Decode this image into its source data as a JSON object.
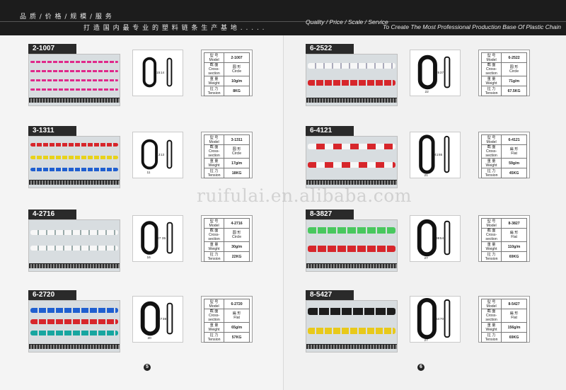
{
  "header": {
    "cn_line1": "品 质  / 价 格  / 规 模  / 服 务",
    "cn_line2": "打 造 国 内 最 专 业 的 塑 料 链 条 生 产 基 地 . . . . .",
    "en_line1": "Quality / Price / Scale / Service",
    "en_line2": "To Create The Most Professional Production Base Of Plastic Chain"
  },
  "watermark": "ruifulai.en.alibaba.com",
  "spec_labels": {
    "model_cn": "型 号",
    "model_en": "Model",
    "cross_cn": "截 面",
    "cross_en": "Cross-section",
    "weight_cn": "重 量",
    "weight_en": "Weight",
    "tension_cn": "拉 力",
    "tension_en": "Tension"
  },
  "products_left": [
    {
      "code": "2-1007",
      "model": "2-1007",
      "section_cn": "圆 形",
      "section_en": "Circle",
      "weight": "10g/m",
      "tension": "8KG",
      "dim_a": "15",
      "dim_b": "14",
      "dim_c": ""
    },
    {
      "code": "3-1311",
      "model": "3-1311",
      "section_cn": "圆 形",
      "section_en": "Circle",
      "weight": "17g/m",
      "tension": "18KG",
      "dim_a": "13",
      "dim_b": "13",
      "dim_c": "11"
    },
    {
      "code": "4-2716",
      "model": "4-2716",
      "section_cn": "圆 形",
      "section_en": "Circle",
      "weight": "30g/m",
      "tension": "22KG",
      "dim_a": "27",
      "dim_b": "35",
      "dim_c": "16"
    },
    {
      "code": "6-2720",
      "model": "6-2720",
      "section_cn": "扁 形",
      "section_en": "Flat",
      "weight": "65g/m",
      "tension": "57KG",
      "dim_a": "27",
      "dim_b": "38",
      "dim_c": "20"
    }
  ],
  "products_right": [
    {
      "code": "6-2522",
      "model": "6-2522",
      "section_cn": "圆 形",
      "section_en": "Circle",
      "weight": "71g/m",
      "tension": "67.5KG",
      "dim_a": "25",
      "dim_b": "37",
      "dim_c": "22"
    },
    {
      "code": "6-4121",
      "model": "6-4121",
      "section_cn": "扁 形",
      "section_en": "Flat",
      "weight": "59g/m",
      "tension": "45KG",
      "dim_a": "41",
      "dim_b": "55",
      "dim_c": "21"
    },
    {
      "code": "8-3827",
      "model": "8-3827",
      "section_cn": "扁 形",
      "section_en": "Flat",
      "weight": "110g/m",
      "tension": "69KG",
      "dim_a": "38",
      "dim_b": "54",
      "dim_c": "27"
    },
    {
      "code": "8-5427",
      "model": "8-5427",
      "section_cn": "扁 形",
      "section_en": "Flat",
      "weight": "156g/m",
      "tension": "69KG",
      "dim_a": "54",
      "dim_b": "70",
      "dim_c": "27"
    }
  ],
  "chain_colors": {
    "pink": "#e0288a",
    "red": "#d7262b",
    "yellow": "#e8d21a",
    "blue": "#1f5fd0",
    "white": "#f4f4f4",
    "green": "#2ea84a",
    "black": "#1d1d1d",
    "teal": "#17a6a0"
  },
  "page_numbers": {
    "left": "5",
    "right": "6"
  }
}
